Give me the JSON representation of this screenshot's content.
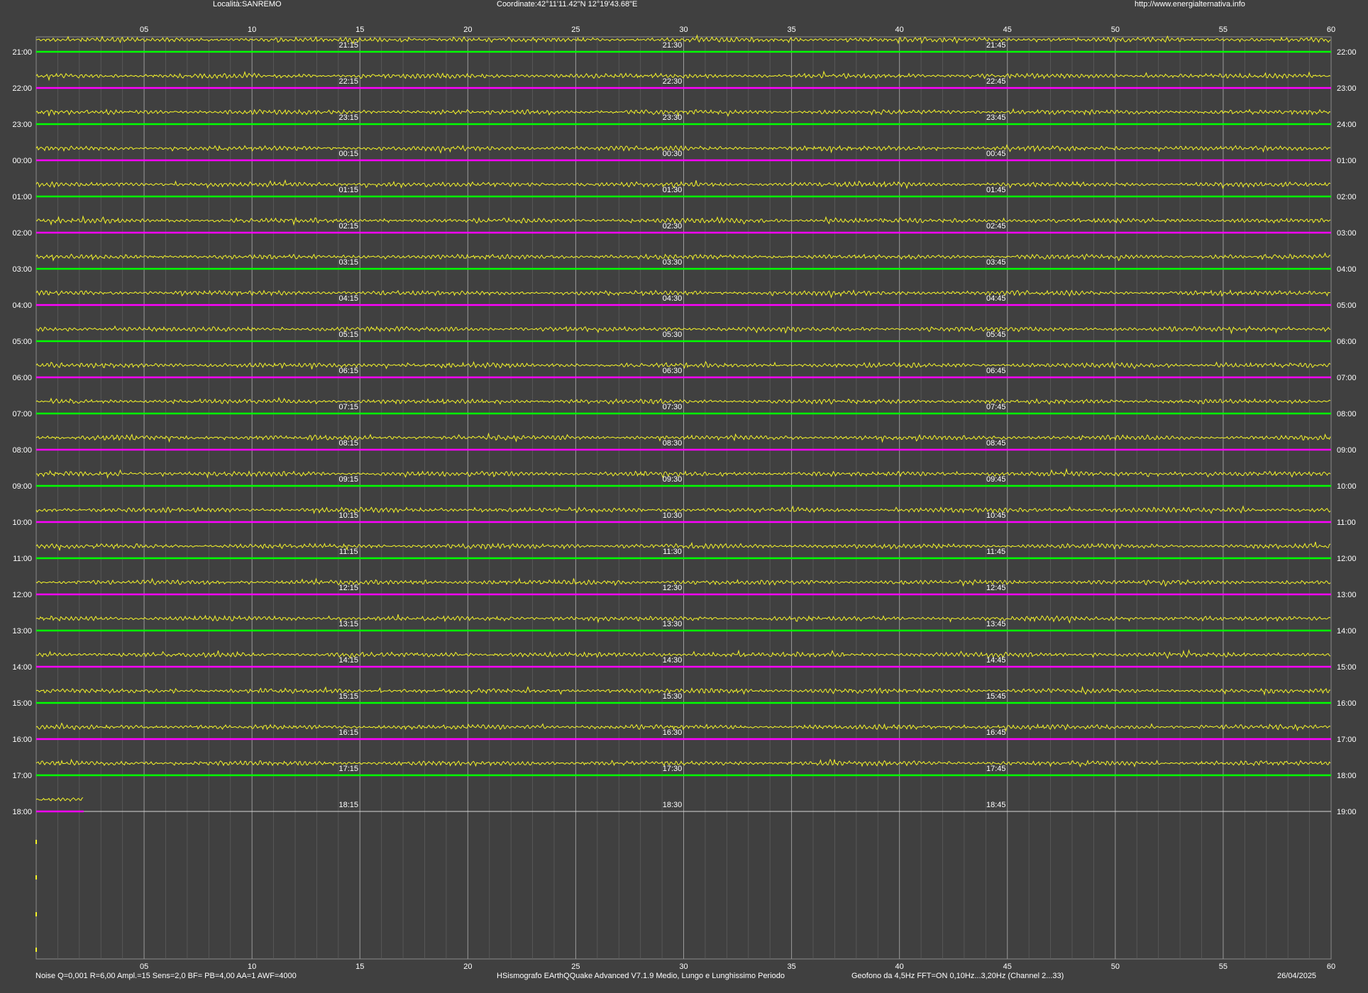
{
  "header": {
    "location": "Località:SANREMO",
    "coordinates": "Coordinate:42°11'11.42\"N  12°19'43.68\"E",
    "website": "http://www.energialternativa.info"
  },
  "footer": {
    "noise_params": "Noise Q=0,001 R=6,00 Ampl.=15 Sens=2,0 BF= PB=4,00 AA=1 AWF=4000",
    "software": "HSismografo  EArthQQuake Advanced V7.1.9  Medio, Lungo e Lunghissimo Periodo",
    "sensor": "Geofono da 4,5Hz FFT=ON 0,10Hz...3,20Hz      (Channel 2...33)",
    "date": "26/04/2025"
  },
  "colors": {
    "background": "#404040",
    "trace": "#f5f52a",
    "baseline_green": "#00ff00",
    "baseline_magenta": "#ff00ff",
    "grid": "#8a8a8a",
    "text": "#ffffff"
  },
  "chart_data": {
    "type": "line",
    "x_range": [
      0,
      60
    ],
    "x_unit": "minutes",
    "x_ticks": [
      "05",
      "10",
      "15",
      "20",
      "25",
      "30",
      "35",
      "40",
      "45",
      "50",
      "55",
      "60"
    ],
    "rows": [
      {
        "left": "21:00",
        "right": "22:00",
        "marks": [
          "21:15",
          "21:30",
          "21:45"
        ],
        "color": "green",
        "minutes": 60
      },
      {
        "left": "22:00",
        "right": "23:00",
        "marks": [
          "22:15",
          "22:30",
          "22:45"
        ],
        "color": "magenta",
        "minutes": 60
      },
      {
        "left": "23:00",
        "right": "24:00",
        "marks": [
          "23:15",
          "23:30",
          "23:45"
        ],
        "color": "green",
        "minutes": 60
      },
      {
        "left": "00:00",
        "right": "01:00",
        "marks": [
          "00:15",
          "00:30",
          "00:45"
        ],
        "color": "magenta",
        "minutes": 60
      },
      {
        "left": "01:00",
        "right": "02:00",
        "marks": [
          "01:15",
          "01:30",
          "01:45"
        ],
        "color": "green",
        "minutes": 60
      },
      {
        "left": "02:00",
        "right": "03:00",
        "marks": [
          "02:15",
          "02:30",
          "02:45"
        ],
        "color": "magenta",
        "minutes": 60
      },
      {
        "left": "03:00",
        "right": "04:00",
        "marks": [
          "03:15",
          "03:30",
          "03:45"
        ],
        "color": "green",
        "minutes": 60
      },
      {
        "left": "04:00",
        "right": "05:00",
        "marks": [
          "04:15",
          "04:30",
          "04:45"
        ],
        "color": "magenta",
        "minutes": 60
      },
      {
        "left": "05:00",
        "right": "06:00",
        "marks": [
          "05:15",
          "05:30",
          "05:45"
        ],
        "color": "green",
        "minutes": 60
      },
      {
        "left": "06:00",
        "right": "07:00",
        "marks": [
          "06:15",
          "06:30",
          "06:45"
        ],
        "color": "magenta",
        "minutes": 60
      },
      {
        "left": "07:00",
        "right": "08:00",
        "marks": [
          "07:15",
          "07:30",
          "07:45"
        ],
        "color": "green",
        "minutes": 60
      },
      {
        "left": "08:00",
        "right": "09:00",
        "marks": [
          "08:15",
          "08:30",
          "08:45"
        ],
        "color": "magenta",
        "minutes": 60
      },
      {
        "left": "09:00",
        "right": "10:00",
        "marks": [
          "09:15",
          "09:30",
          "09:45"
        ],
        "color": "green",
        "minutes": 60
      },
      {
        "left": "10:00",
        "right": "11:00",
        "marks": [
          "10:15",
          "10:30",
          "10:45"
        ],
        "color": "magenta",
        "minutes": 60
      },
      {
        "left": "11:00",
        "right": "12:00",
        "marks": [
          "11:15",
          "11:30",
          "11:45"
        ],
        "color": "green",
        "minutes": 60
      },
      {
        "left": "12:00",
        "right": "13:00",
        "marks": [
          "12:15",
          "12:30",
          "12:45"
        ],
        "color": "magenta",
        "minutes": 60
      },
      {
        "left": "13:00",
        "right": "14:00",
        "marks": [
          "13:15",
          "13:30",
          "13:45"
        ],
        "color": "green",
        "minutes": 60
      },
      {
        "left": "14:00",
        "right": "15:00",
        "marks": [
          "14:15",
          "14:30",
          "14:45"
        ],
        "color": "magenta",
        "minutes": 60
      },
      {
        "left": "15:00",
        "right": "16:00",
        "marks": [
          "15:15",
          "15:30",
          "15:45"
        ],
        "color": "green",
        "minutes": 60
      },
      {
        "left": "16:00",
        "right": "17:00",
        "marks": [
          "16:15",
          "16:30",
          "16:45"
        ],
        "color": "magenta",
        "minutes": 60
      },
      {
        "left": "17:00",
        "right": "18:00",
        "marks": [
          "17:15",
          "17:30",
          "17:45"
        ],
        "color": "green",
        "minutes": 60
      },
      {
        "left": "18:00",
        "right": "19:00",
        "marks": [
          "18:15",
          "18:30",
          "18:45"
        ],
        "color": "magenta",
        "minutes": 2.2
      }
    ]
  }
}
